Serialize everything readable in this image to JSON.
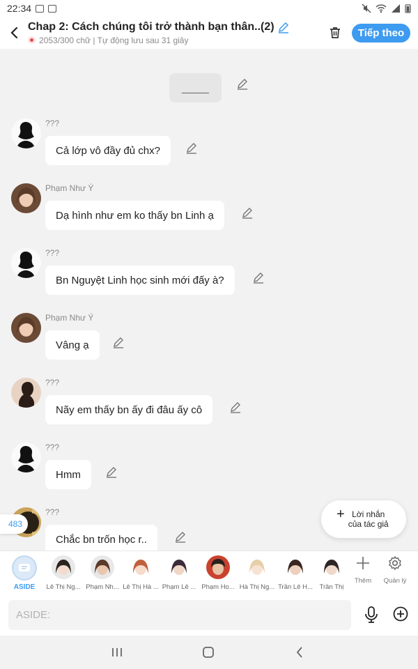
{
  "status_bar": {
    "time": "22:34"
  },
  "header": {
    "title": "Chap 2: Cách chúng tôi trở thành bạn thân..(2)",
    "subtitle": "2053/300 chữ | Tự động lưu sau 31 giây",
    "next_label": "Tiếp theo"
  },
  "chat": {
    "divider_text": "_____",
    "messages": [
      {
        "sender": "???",
        "text": "Cả lớp vô đầy đủ chx?",
        "avatar": "silhouette-icon"
      },
      {
        "sender": "Phạm Như Ý",
        "text": "Dạ hình như em ko thấy bn Linh ạ",
        "avatar": "girl-brown-hair"
      },
      {
        "sender": "???",
        "text": "Bn Nguyệt Linh học sinh mới đấy à?",
        "avatar": "silhouette-icon"
      },
      {
        "sender": "Phạm Như Ý",
        "text": "Vâng ạ",
        "avatar": "girl-brown-hair"
      },
      {
        "sender": "???",
        "text": "Nãy em thấy bn ấy đi đâu ấy cô",
        "avatar": "silhouette-beige"
      },
      {
        "sender": "???",
        "text": "Hmm",
        "avatar": "silhouette-icon"
      },
      {
        "sender": "???",
        "text": "Chắc bn trốn học r..",
        "avatar": "silhouette-gold"
      }
    ]
  },
  "counter": "483",
  "author_note": {
    "line1": "Lời nhắn",
    "line2": "của tác giả"
  },
  "characters": {
    "aside_label": "ASIDE",
    "list": [
      {
        "name": "Lê Thị Ng...",
        "hair": "#2a2420",
        "skin": "#f3dccd"
      },
      {
        "name": "Phạm Nh...",
        "hair": "#5a3a28",
        "skin": "#e9c7ae"
      },
      {
        "name": "Lê Thị Hà ...",
        "hair": "#c0603e",
        "skin": "#f6dccb"
      },
      {
        "name": "Phạm Lê ...",
        "hair": "#3a2a3a",
        "skin": "#f0d6c6"
      },
      {
        "name": "Phạm Ho...",
        "hair": "#2b211d",
        "skin": "#e8c3a6"
      },
      {
        "name": "Hà Thị Ng...",
        "hair": "#e6cfa8",
        "skin": "#f7e3d5"
      },
      {
        "name": "Trần Lê H...",
        "hair": "#3a2520",
        "skin": "#eccfbd"
      },
      {
        "name": "Trần Thị",
        "hair": "#2e2626",
        "skin": "#efd8ca"
      }
    ],
    "more_label": "Thêm",
    "manage_label": "Quản lý"
  },
  "input": {
    "placeholder": "ASIDE:"
  },
  "colors": {
    "accent": "#3d9bf0",
    "background": "#f2f2f2"
  }
}
